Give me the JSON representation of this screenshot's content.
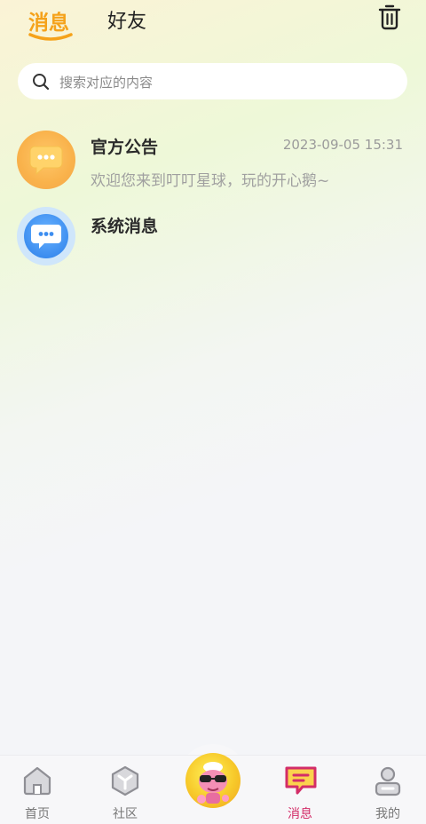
{
  "tabs": {
    "messages_label": "消息",
    "friends_label": "好友",
    "active_color": "#f5a21a"
  },
  "search": {
    "placeholder": "搜索对应的内容"
  },
  "messages": [
    {
      "title": "官方公告",
      "time": "2023-09-05 15:31",
      "preview": "欢迎您来到叮叮星球，玩的开心鹅~",
      "icon": "chat-bubble-icon",
      "color": "#f9b24b"
    },
    {
      "title": "系统消息",
      "icon": "chat-bubble-icon",
      "color": "#3d8ef0"
    }
  ],
  "bottom_nav": {
    "items": [
      {
        "label": "首页",
        "icon": "home-icon"
      },
      {
        "label": "社区",
        "icon": "community-icon"
      },
      {
        "label": "消息",
        "icon": "message-icon",
        "active": true
      },
      {
        "label": "我的",
        "icon": "profile-icon"
      }
    ],
    "active_color": "#d32d68",
    "center_icon": "mascot-icon"
  }
}
